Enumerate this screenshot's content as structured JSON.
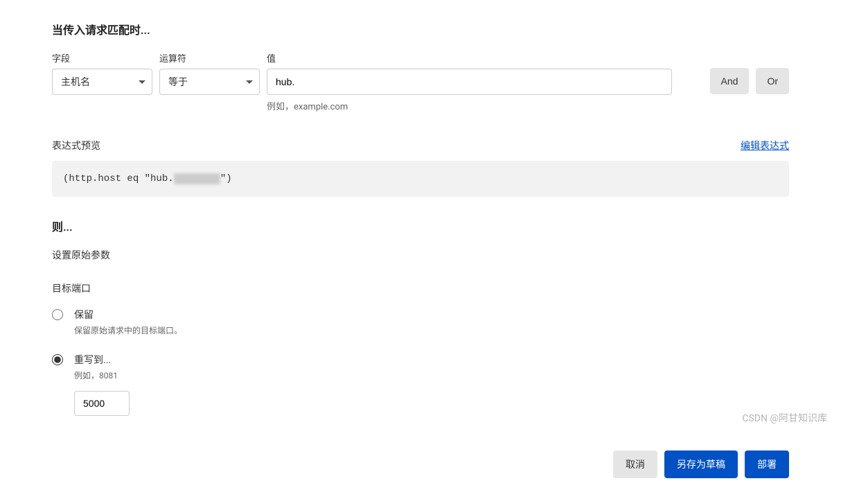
{
  "match_section": {
    "title": "当传入请求匹配时...",
    "field_label": "字段",
    "operator_label": "运算符",
    "value_label": "值",
    "field_value": "主机名",
    "operator_value": "等于",
    "input_value": "hub.",
    "value_hint": "例如，example.com",
    "and_label": "And",
    "or_label": "Or"
  },
  "preview": {
    "title": "表达式预览",
    "edit_link": "编辑表达式",
    "expression_prefix": "(http.host eq \"hub.",
    "expression_hidden": "xxxx xxx",
    "expression_suffix": "\")"
  },
  "then_section": {
    "title": "则...",
    "subtitle": "设置原始参数",
    "port_title": "目标端口",
    "keep_option": {
      "label": "保留",
      "hint": "保留原始请求中的目标端口。"
    },
    "rewrite_option": {
      "label": "重写到...",
      "hint": "例如，8081",
      "value": "5000"
    }
  },
  "footer": {
    "cancel": "取消",
    "save_draft": "另存为草稿",
    "deploy": "部署"
  },
  "watermark": "CSDN @阿甘知识库"
}
